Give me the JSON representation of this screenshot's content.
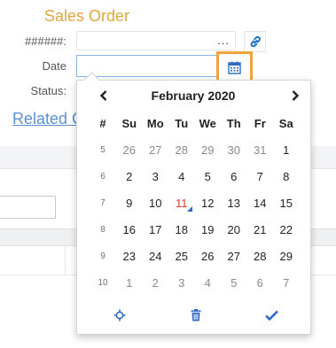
{
  "form": {
    "title": "Sales Order",
    "number_label": "######:",
    "number_dots": "...",
    "date_label": "Date",
    "date_value": "",
    "status_label": "Status:",
    "related_link": "Related C"
  },
  "icons": {
    "link": "link-icon",
    "calendar": "calendar-icon",
    "prev": "chevron-left-icon",
    "next": "chevron-right-icon",
    "now": "crosshair-icon",
    "clear": "trash-icon",
    "ok": "check-icon"
  },
  "colors": {
    "title": "#e0a73a",
    "accent": "#2d6bc4",
    "today": "#e03a30",
    "highlight_border": "#f4a23c",
    "link": "#5b8fd8"
  },
  "datepicker": {
    "month_title": "February 2020",
    "week_header": "#",
    "weekdays": [
      "Su",
      "Mo",
      "Tu",
      "We",
      "Th",
      "Fr",
      "Sa"
    ],
    "weeks": [
      {
        "num": "5",
        "days": [
          {
            "d": "26",
            "other": true
          },
          {
            "d": "27",
            "other": true
          },
          {
            "d": "28",
            "other": true
          },
          {
            "d": "29",
            "other": true
          },
          {
            "d": "30",
            "other": true
          },
          {
            "d": "31",
            "other": true
          },
          {
            "d": "1"
          }
        ]
      },
      {
        "num": "6",
        "days": [
          {
            "d": "2"
          },
          {
            "d": "3"
          },
          {
            "d": "4"
          },
          {
            "d": "5"
          },
          {
            "d": "6"
          },
          {
            "d": "7"
          },
          {
            "d": "8"
          }
        ]
      },
      {
        "num": "7",
        "days": [
          {
            "d": "9"
          },
          {
            "d": "10"
          },
          {
            "d": "11",
            "today": true
          },
          {
            "d": "12"
          },
          {
            "d": "13"
          },
          {
            "d": "14"
          },
          {
            "d": "15"
          }
        ]
      },
      {
        "num": "8",
        "days": [
          {
            "d": "16"
          },
          {
            "d": "17"
          },
          {
            "d": "18"
          },
          {
            "d": "19"
          },
          {
            "d": "20"
          },
          {
            "d": "21"
          },
          {
            "d": "22"
          }
        ]
      },
      {
        "num": "9",
        "days": [
          {
            "d": "23"
          },
          {
            "d": "24"
          },
          {
            "d": "25"
          },
          {
            "d": "26"
          },
          {
            "d": "27"
          },
          {
            "d": "28"
          },
          {
            "d": "29"
          }
        ]
      },
      {
        "num": "10",
        "days": [
          {
            "d": "1",
            "other": true
          },
          {
            "d": "2",
            "other": true
          },
          {
            "d": "3",
            "other": true
          },
          {
            "d": "4",
            "other": true
          },
          {
            "d": "5",
            "other": true
          },
          {
            "d": "6",
            "other": true
          },
          {
            "d": "7",
            "other": true
          }
        ]
      }
    ]
  }
}
